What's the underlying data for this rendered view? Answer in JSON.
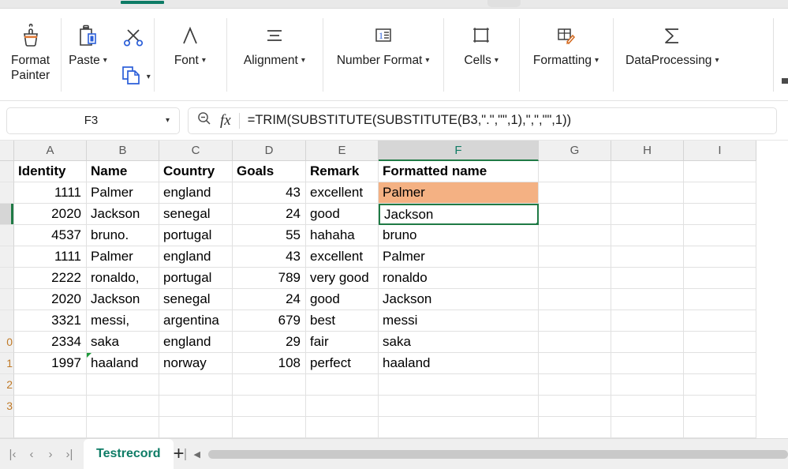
{
  "window": {
    "active_ribbon_tab_indicator": true,
    "accent_teal": "#0e7c66",
    "accent_green": "#1f7a45",
    "fill_orange": "#f4b183"
  },
  "ribbon": {
    "groups": [
      {
        "name": "clipboard-format-painter",
        "buttons": [
          {
            "name": "format-painter",
            "label_line1": "Format",
            "label_line2": "Painter",
            "icon": "format-painter-icon",
            "caret": false
          }
        ]
      },
      {
        "name": "clipboard",
        "buttons": [
          {
            "name": "paste",
            "label": "Paste",
            "icon": "paste-icon",
            "caret": true
          },
          {
            "name": "cut",
            "label": "",
            "icon": "scissors-icon",
            "caret": false
          },
          {
            "name": "copy",
            "label": "",
            "icon": "copy-icon",
            "caret": true
          }
        ]
      },
      {
        "name": "font",
        "buttons": [
          {
            "name": "font",
            "label": "Font",
            "icon": "font-A-icon",
            "caret": true
          }
        ]
      },
      {
        "name": "alignment",
        "buttons": [
          {
            "name": "alignment",
            "label": "Alignment",
            "icon": "alignment-lines-icon",
            "caret": true
          }
        ]
      },
      {
        "name": "number-format",
        "buttons": [
          {
            "name": "number-format",
            "label": "Number Format",
            "icon": "number-format-icon",
            "caret": true
          }
        ]
      },
      {
        "name": "cells",
        "buttons": [
          {
            "name": "cells",
            "label": "Cells",
            "icon": "cells-square-icon",
            "caret": true
          }
        ]
      },
      {
        "name": "formatting",
        "buttons": [
          {
            "name": "formatting",
            "label": "Formatting",
            "icon": "formatting-table-brush-icon",
            "caret": true
          }
        ]
      },
      {
        "name": "data-processing",
        "buttons": [
          {
            "name": "data-processing",
            "label": "DataProcessing",
            "icon": "sigma-icon",
            "caret": true
          }
        ]
      }
    ]
  },
  "formula_bar": {
    "name_box_value": "F3",
    "name_box_caret": "chevron-down-icon",
    "search_icon": "zoom-out-magnifier-icon",
    "fx_icon": "fx-icon",
    "fx_label": "fx",
    "formula": "=TRIM(SUBSTITUTE(SUBSTITUTE(B3,\".\",\"\",1),\",\",\"\",1))"
  },
  "grid": {
    "column_headers": [
      "A",
      "B",
      "C",
      "D",
      "E",
      "F",
      "G",
      "H",
      "I"
    ],
    "selected_column": "F",
    "active_cell": "F3",
    "row_headers": [
      "",
      "",
      "",
      "",
      "",
      "",
      "",
      "",
      "0",
      "1",
      "2",
      "3"
    ],
    "columns": [
      "Identity",
      "Name",
      "Country",
      "Goals",
      "Remark",
      "Formatted name"
    ],
    "rows": [
      {
        "identity": "1111",
        "name": "Palmer",
        "country": "england",
        "goals": "43",
        "remark": "excellent",
        "formatted": "Palmer",
        "fill": "orange",
        "err": false
      },
      {
        "identity": "2020",
        "name": "Jackson",
        "country": "senegal",
        "goals": "24",
        "remark": "good",
        "formatted": "Jackson",
        "fill": "active",
        "err": false
      },
      {
        "identity": "4537",
        "name": "bruno.",
        "country": "portugal",
        "goals": "55",
        "remark": "hahaha",
        "formatted": "bruno",
        "fill": "none",
        "err": false
      },
      {
        "identity": "1111",
        "name": "Palmer",
        "country": "england",
        "goals": "43",
        "remark": "excellent",
        "formatted": "Palmer",
        "fill": "none",
        "err": false
      },
      {
        "identity": "2222",
        "name": "ronaldo,",
        "country": "portugal",
        "goals": "789",
        "remark": "very good",
        "formatted": "ronaldo",
        "fill": "none",
        "err": false
      },
      {
        "identity": "2020",
        "name": "Jackson",
        "country": "senegal",
        "goals": "24",
        "remark": "good",
        "formatted": "Jackson",
        "fill": "none",
        "err": false
      },
      {
        "identity": "3321",
        "name": "messi,",
        "country": "argentina",
        "goals": "679",
        "remark": "best",
        "formatted": "messi",
        "fill": "none",
        "err": false
      },
      {
        "identity": "2334",
        "name": "saka",
        "country": "england",
        "goals": "29",
        "remark": "fair",
        "formatted": "saka",
        "fill": "none",
        "err": false
      },
      {
        "identity": "1997",
        "name": "haaland",
        "country": "norway",
        "goals": "108",
        "remark": "perfect",
        "formatted": "haaland",
        "fill": "none",
        "err": true
      }
    ]
  },
  "sheet_bar": {
    "nav": [
      {
        "name": "first-sheet-button",
        "glyph": "|‹"
      },
      {
        "name": "prev-sheet-button",
        "glyph": "‹"
      },
      {
        "name": "next-sheet-button",
        "glyph": "›"
      },
      {
        "name": "last-sheet-button",
        "glyph": "›|"
      }
    ],
    "tabs": [
      {
        "name": "sheet-tab-testrecord",
        "label": "Testrecord",
        "active": true
      }
    ],
    "add_sheet_label": "+",
    "scroll_left_arrow": "◀"
  }
}
